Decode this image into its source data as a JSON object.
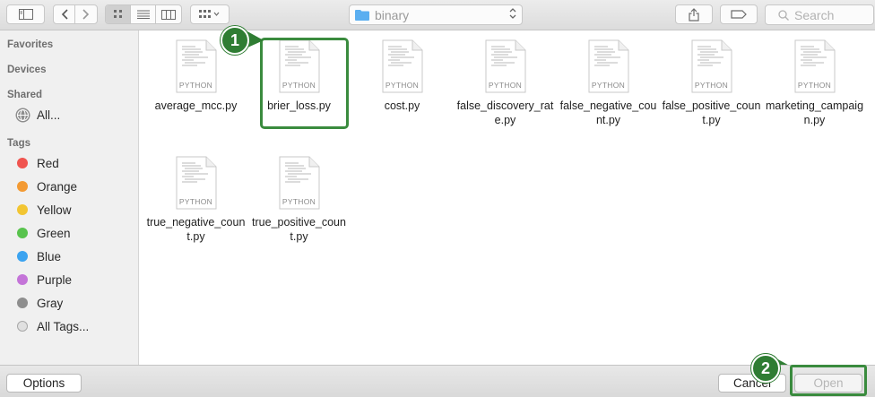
{
  "toolbar": {
    "view_modes": [
      "icon-view",
      "list-view",
      "column-view"
    ],
    "location": "binary",
    "search_placeholder": "Search"
  },
  "sidebar": {
    "favorites_header": "Favorites",
    "devices_header": "Devices",
    "shared_header": "Shared",
    "shared_item": "All...",
    "tags_header": "Tags",
    "tags": [
      {
        "label": "Red",
        "color": "#f0544f"
      },
      {
        "label": "Orange",
        "color": "#f39a33"
      },
      {
        "label": "Yellow",
        "color": "#f2c532"
      },
      {
        "label": "Green",
        "color": "#58c34d"
      },
      {
        "label": "Blue",
        "color": "#3ba3f0"
      },
      {
        "label": "Purple",
        "color": "#c474d8"
      },
      {
        "label": "Gray",
        "color": "#8e8e8e"
      },
      {
        "label": "All Tags...",
        "color": ""
      }
    ]
  },
  "files": [
    {
      "name": "average_mcc.py",
      "kind": "PYTHON"
    },
    {
      "name": "brier_loss.py",
      "kind": "PYTHON"
    },
    {
      "name": "cost.py",
      "kind": "PYTHON"
    },
    {
      "name": "false_discovery_rate.py",
      "kind": "PYTHON"
    },
    {
      "name": "false_negative_count.py",
      "kind": "PYTHON"
    },
    {
      "name": "false_positive_count.py",
      "kind": "PYTHON"
    },
    {
      "name": "marketing_campaign.py",
      "kind": "PYTHON"
    },
    {
      "name": "true_negative_count.py",
      "kind": "PYTHON"
    },
    {
      "name": "true_positive_count.py",
      "kind": "PYTHON"
    }
  ],
  "annotations": {
    "step1": "1",
    "step2": "2",
    "accent": "#2f7d33"
  },
  "bottom": {
    "options": "Options",
    "cancel": "Cancel",
    "open": "Open"
  }
}
